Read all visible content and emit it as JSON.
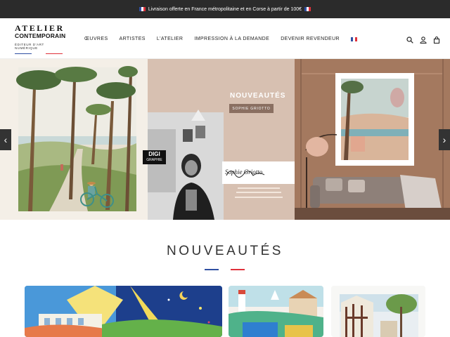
{
  "announcement": {
    "text": "Livraison offerte en France métropolitaine et en Corse à partir de 100€"
  },
  "brand": {
    "line1": "ATELIER",
    "line2": "CONTEMPORAIN",
    "tagline": "ÉDITEUR D'ART NUMÉRIQUE"
  },
  "nav": {
    "items": [
      {
        "label": "ŒUVRES"
      },
      {
        "label": "ARTISTES"
      },
      {
        "label": "L'ATELIER"
      },
      {
        "label": "IMPRESSION À LA DEMANDE"
      },
      {
        "label": "DEVENIR REVENDEUR"
      }
    ]
  },
  "header_icons": [
    "search-icon",
    "account-icon",
    "cart-icon"
  ],
  "hero": {
    "banner_title": "NOUVEAUTÉS",
    "banner_button": "SOPHIE GRIOTTO",
    "digi_badge_line1": "DIGI",
    "digi_badge_line2": "GRAPHIE",
    "signature": "Sophie Griotto"
  },
  "section": {
    "title": "NOUVEAUTÉS"
  },
  "colors": {
    "topbar": "#2b2b2b",
    "french_blue": "#2f4fa2",
    "french_red": "#e0313b",
    "accent_button": "#8a6f61"
  }
}
